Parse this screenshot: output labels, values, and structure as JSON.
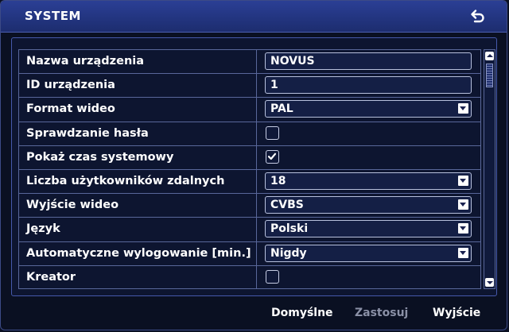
{
  "window": {
    "title": "SYSTEM"
  },
  "settings": [
    {
      "label": "Nazwa urządzenia",
      "type": "text",
      "value": "NOVUS"
    },
    {
      "label": "ID urządzenia",
      "type": "text",
      "value": "1"
    },
    {
      "label": "Format wideo",
      "type": "select",
      "value": "PAL"
    },
    {
      "label": "Sprawdzanie hasła",
      "type": "checkbox",
      "checked": false
    },
    {
      "label": "Pokaż czas systemowy",
      "type": "checkbox",
      "checked": true
    },
    {
      "label": "Liczba użytkowników zdalnych",
      "type": "select",
      "value": "18"
    },
    {
      "label": "Wyjście wideo",
      "type": "select",
      "value": "CVBS"
    },
    {
      "label": "Język",
      "type": "select",
      "value": "Polski"
    },
    {
      "label": "Automatyczne wylogowanie [min.]",
      "type": "select",
      "value": "Nigdy"
    },
    {
      "label": "Kreator",
      "type": "checkbox",
      "checked": false
    }
  ],
  "footer": {
    "default_label": "Domyślne",
    "apply_label": "Zastosuj",
    "apply_disabled": true,
    "exit_label": "Wyjście"
  },
  "icons": {
    "back": "back-arrow-icon",
    "checkmark": "checkmark-icon",
    "dropdown": "chevron-down-icon"
  },
  "colors": {
    "titlebar": "#22347e",
    "background": "#0a1022",
    "text": "#ffffff",
    "disabled_text": "#8a90a6"
  }
}
